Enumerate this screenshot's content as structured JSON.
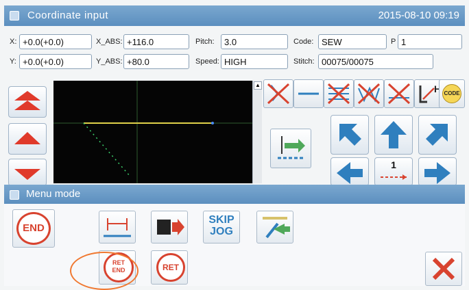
{
  "window": {
    "title": "Coordinate input",
    "datetime": "2015-08-10 09:19"
  },
  "fields": {
    "x_label": "X:",
    "x_value": "+0.0(+0.0)",
    "y_label": "Y:",
    "y_value": "+0.0(+0.0)",
    "x_abs_label": "X_ABS:",
    "x_abs_value": "+116.0",
    "y_abs_label": "Y_ABS:",
    "y_abs_value": "+80.0",
    "pitch_label": "Pitch:",
    "pitch_value": "3.0",
    "speed_label": "Speed:",
    "speed_value": "HIGH",
    "code_label": "Code:",
    "code_value": "SEW",
    "p_label": "P",
    "p_value": "1",
    "stitch_label": "Stitch:",
    "stitch_value": "00075/00075"
  },
  "toolbar": {
    "h_label": "H",
    "code_label": "CODE",
    "move_label": "1"
  },
  "menu": {
    "title": "Menu mode",
    "end_label": "END",
    "skip_label": "SKIP",
    "jog_label": "JOG",
    "ret_end_top": "RET",
    "ret_end_bottom": "END",
    "ret_label": "RET"
  },
  "colors": {
    "title_bar": "#5c8fbf",
    "accent_red": "#d8432f",
    "arrow_blue": "#2f7fbe",
    "canvas_bg": "#050505"
  }
}
